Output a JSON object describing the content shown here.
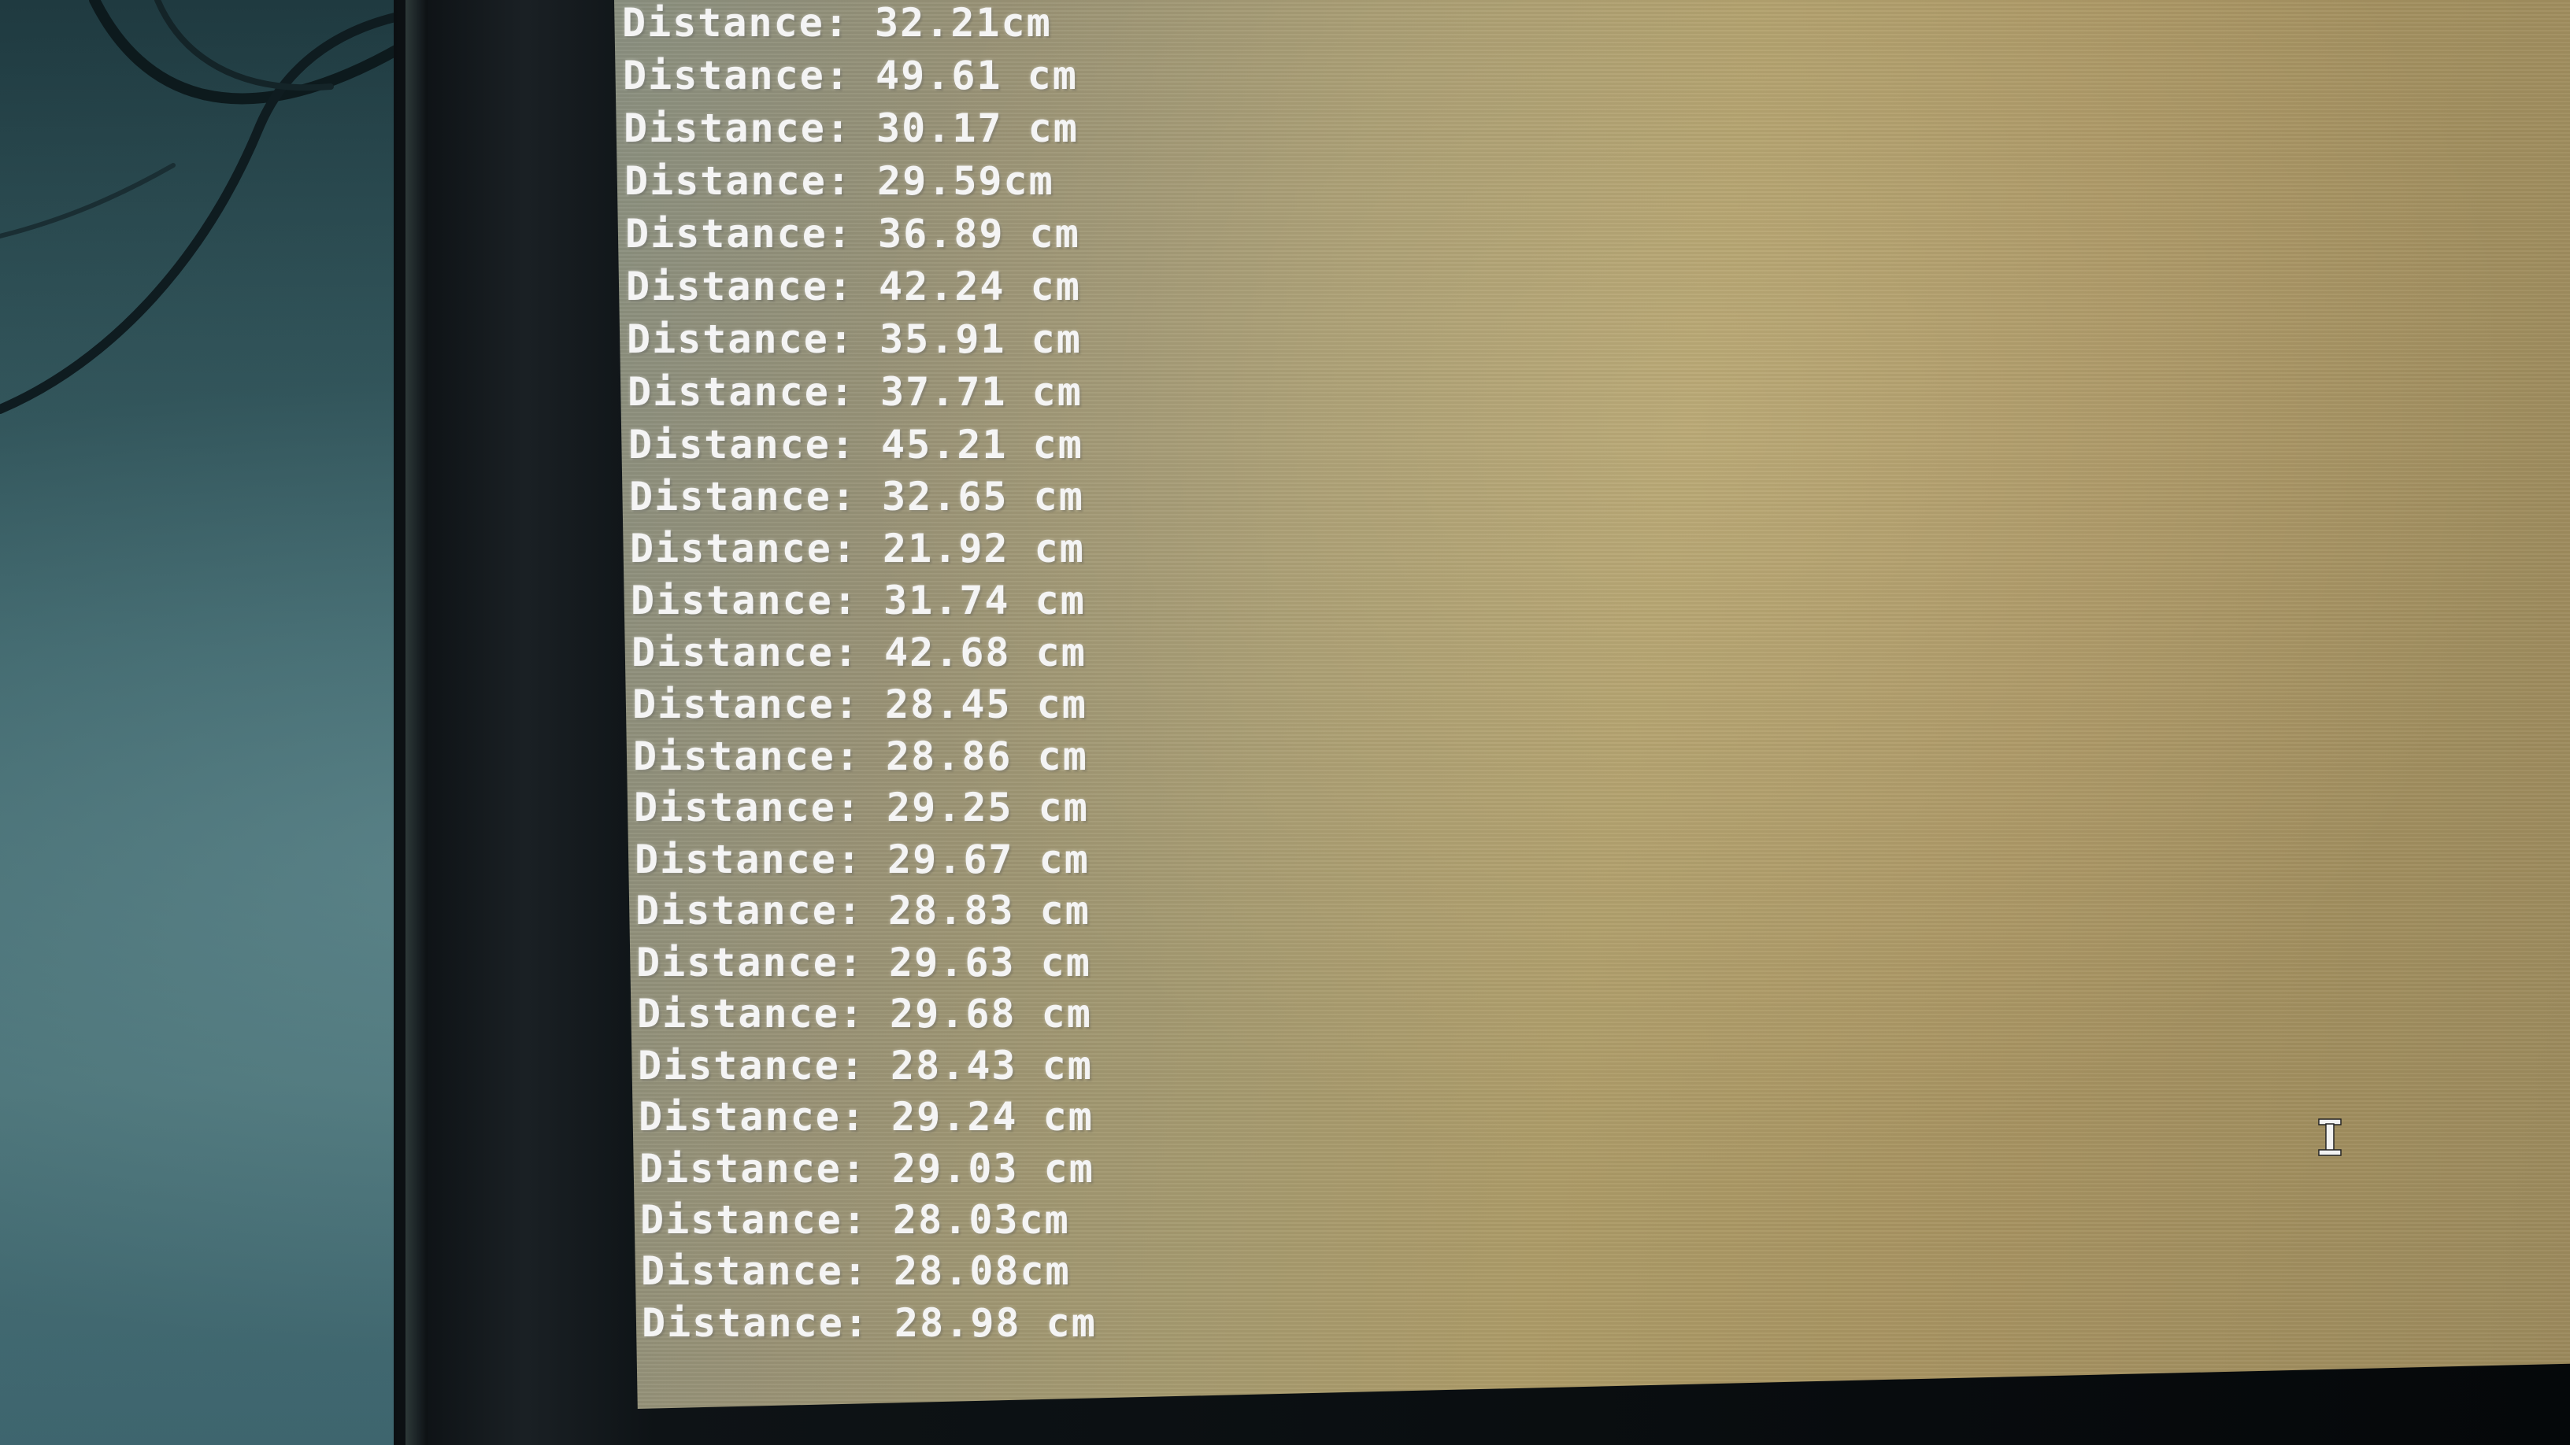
{
  "terminal": {
    "lines": [
      "Distance: 32.21cm",
      "Distance: 49.61 cm",
      "Distance: 30.17 cm",
      "Distance: 29.59cm",
      "Distance: 36.89 cm",
      "Distance: 42.24 cm",
      "Distance: 35.91 cm",
      "Distance: 37.71 cm",
      "Distance: 45.21 cm",
      "Distance: 32.65 cm",
      "Distance: 21.92 cm",
      "Distance: 31.74 cm",
      "Distance: 42.68 cm",
      "Distance: 28.45 cm",
      "Distance: 28.86 cm",
      "Distance: 29.25 cm",
      "Distance: 29.67 cm",
      "Distance: 28.83 cm",
      "Distance: 29.63 cm",
      "Distance: 29.68 cm",
      "Distance: 28.43 cm",
      "Distance: 29.24 cm",
      "Distance: 29.03 cm",
      "Distance: 28.03cm",
      "Distance: 28.08cm",
      "Distance: 28.98 cm"
    ]
  },
  "colors": {
    "text": "#f4f4f4",
    "screen": "#a59a70",
    "bezel": "#0b0f12",
    "desk": "#3a6268"
  },
  "icons": {
    "cursor": "text-cursor-ibeam-icon"
  }
}
